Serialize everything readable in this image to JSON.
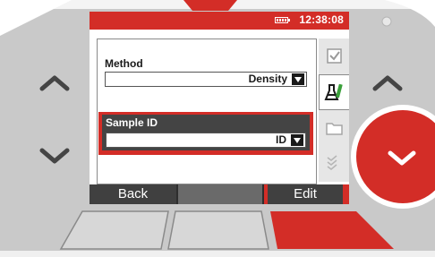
{
  "status": {
    "time": "12:38:08"
  },
  "form": {
    "method": {
      "label": "Method",
      "value": "Density"
    },
    "sample_id": {
      "label": "Sample ID",
      "value": "ID"
    }
  },
  "softkeys": {
    "back": "Back",
    "middle": "",
    "edit": "Edit"
  },
  "colors": {
    "accent": "#d32d27",
    "dark": "#404040",
    "device_gray": "#c8c8c8"
  },
  "icons": {
    "tabs": [
      "checklist-icon",
      "flask-edit-icon",
      "folder-icon",
      "multi-check-icon"
    ],
    "nav": [
      "chevron-up-icon",
      "chevron-down-icon",
      "chevron-down-round-icon"
    ]
  }
}
